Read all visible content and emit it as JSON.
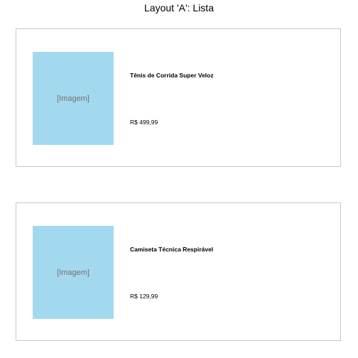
{
  "page": {
    "title": "Layout 'A': Lista"
  },
  "products": [
    {
      "image_placeholder": "[Imagem]",
      "name": "Tênis de Corrida Super Veloz",
      "price": "R$ 499,99"
    },
    {
      "image_placeholder": "[Imagem]",
      "name": "Camiseta Técnica Respirável",
      "price": "R$ 129,99"
    }
  ],
  "colors": {
    "image_placeholder_bg": "#a3d9ef",
    "card_border": "#c8c8c8",
    "placeholder_text": "#707070"
  }
}
